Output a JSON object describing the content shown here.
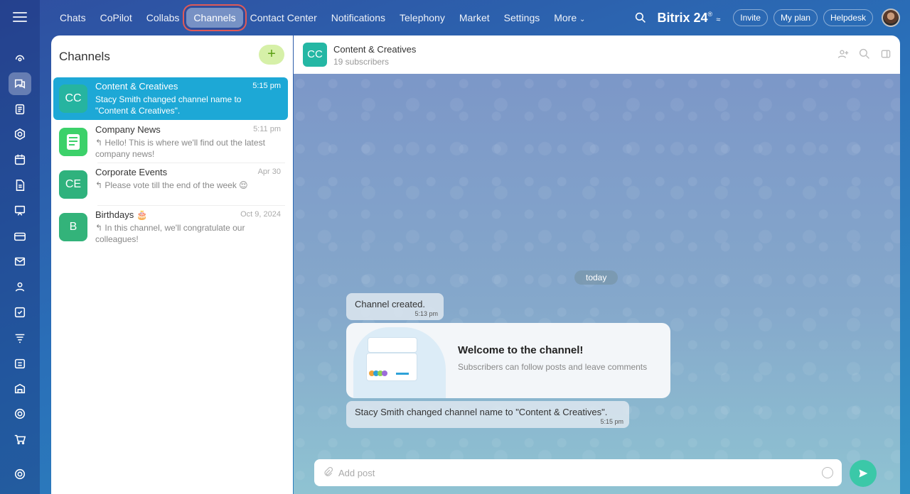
{
  "nav": {
    "items": [
      "Chats",
      "CoPilot",
      "Collabs",
      "Channels",
      "Contact Center",
      "Notifications",
      "Telephony",
      "Market",
      "Settings",
      "More"
    ],
    "active": "Channels",
    "brand": "Bitrix 24",
    "brand_mark": "®",
    "invite": "Invite",
    "my_plan": "My plan",
    "helpdesk": "Helpdesk"
  },
  "rail": {
    "icons": [
      "menu-icon",
      "activity-icon",
      "chat-icon",
      "feed-icon",
      "hexagon-icon",
      "calendar-icon",
      "document-icon",
      "board-icon",
      "card-icon",
      "mail-icon",
      "team-icon",
      "check-icon",
      "filter-icon",
      "schedule-icon",
      "store-icon",
      "target-icon",
      "cart-icon",
      "settings-icon"
    ]
  },
  "channels_panel": {
    "title": "Channels",
    "add_label": "+",
    "items": [
      {
        "initials": "CC",
        "name": "Content & Creatives",
        "time": "5:15 pm",
        "message": "Stacy Smith changed channel name to \"Content & Creatives\".",
        "color": "#26b4a0",
        "active": true
      },
      {
        "initials": "",
        "name": "Company News",
        "time": "5:11 pm",
        "message": "↰ Hello! This is where we'll find out the latest company news!",
        "color": "#3cd16a",
        "active": false
      },
      {
        "initials": "CE",
        "name": "Corporate Events",
        "time": "Apr 30",
        "message": "↰ Please vote till the end of the week 😌",
        "color": "#2fb27d",
        "active": false
      },
      {
        "initials": "B",
        "name": "Birthdays 🎂",
        "time": "Oct 9, 2024",
        "message": "↰ In this channel, we'll congratulate our colleagues!",
        "color": "#33b37a",
        "active": false
      }
    ]
  },
  "chat": {
    "initials": "CC",
    "title": "Content & Creatives",
    "subtitle": "19 subscribers",
    "date_label": "today",
    "messages": [
      {
        "text": "Channel created.",
        "time": "5:13 pm"
      },
      {
        "text": "Stacy Smith changed channel name to \"Content & Creatives\".",
        "time": "5:15 pm"
      }
    ],
    "welcome_title": "Welcome to the channel!",
    "welcome_sub": "Subscribers can follow posts and leave comments",
    "composer_placeholder": "Add post"
  },
  "colors": {
    "accent": "#1da8d6",
    "send": "#3bc8a8",
    "highlight_ring": "#e05a57"
  }
}
